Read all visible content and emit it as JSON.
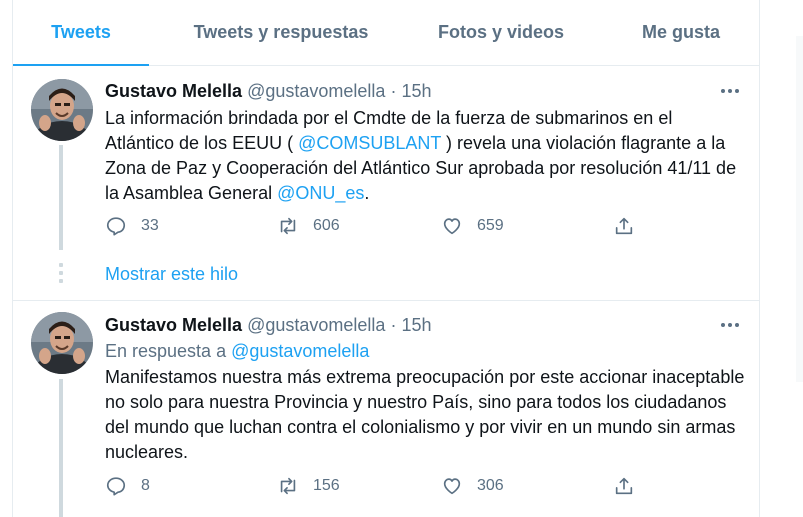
{
  "tabs": [
    {
      "label": "Tweets",
      "active": true
    },
    {
      "label": "Tweets y respuestas",
      "active": false
    },
    {
      "label": "Fotos y videos",
      "active": false
    },
    {
      "label": "Me gusta",
      "active": false
    }
  ],
  "tweets": [
    {
      "name": "Gustavo Melella",
      "handle": "@gustavomelella",
      "separator": "·",
      "time": "15h",
      "body_parts": [
        "La información brindada por el Cmdte de la fuerza de submarinos en el Atlántico de los EEUU ( ",
        "@COMSUBLANT",
        " ) revela una violación flagrante a la Zona de Paz y Cooperación del Atlántico Sur aprobada por resolución 41/11 de la Asamblea General ",
        "@ONU_es",
        "."
      ],
      "replies": "33",
      "retweets": "606",
      "likes": "659"
    },
    {
      "name": "Gustavo Melella",
      "handle": "@gustavomelella",
      "separator": "·",
      "time": "15h",
      "reply_prefix": "En respuesta a",
      "reply_handle": "@gustavomelella",
      "body": "Manifestamos nuestra más extrema preocupación por este accionar inaceptable no solo para nuestra Provincia y nuestro País, sino para todos los ciudadanos del mundo que luchan contra el colonialismo y por vivir en un mundo sin armas nucleares.",
      "replies": "8",
      "retweets": "156",
      "likes": "306"
    }
  ],
  "show_thread": "Mostrar este hilo",
  "colors": {
    "accent": "#1da1f2",
    "secondary_text": "#5b7083",
    "divider": "#e6ecf0",
    "thread_line": "#cfd9de"
  },
  "icons": [
    "more-icon",
    "reply-icon",
    "retweet-icon",
    "like-icon",
    "share-icon"
  ]
}
